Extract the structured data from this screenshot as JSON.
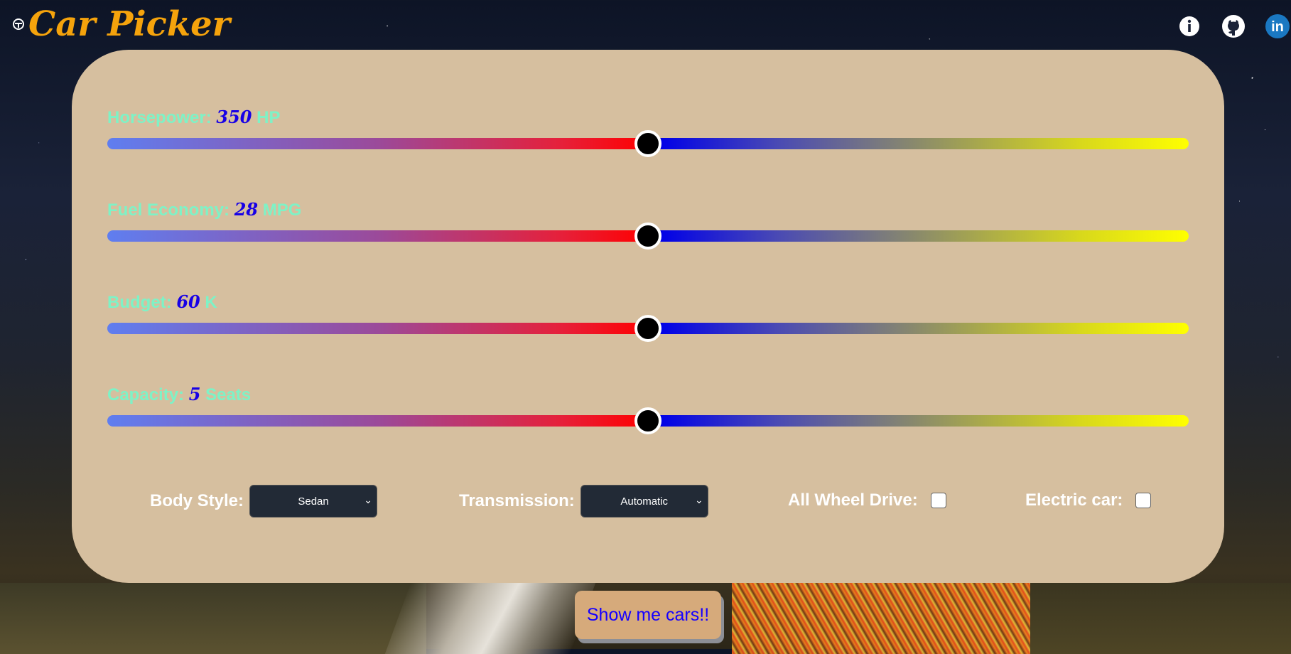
{
  "header": {
    "title": "Car Picker",
    "brand_icon": "steering-wheel-icon",
    "icons": [
      "info-icon",
      "github-icon",
      "linkedin-icon"
    ]
  },
  "sliders": [
    {
      "label": "Horsepower:",
      "value": "350",
      "unit": "HP",
      "level": 0.5
    },
    {
      "label": "Fuel Economy:",
      "value": "28",
      "unit": "MPG",
      "level": 0.5
    },
    {
      "label": "Budget:",
      "value": "60",
      "unit": "K",
      "level": 0.5
    },
    {
      "label": "Capacity:",
      "value": "5",
      "unit": "Seats",
      "level": 0.5
    }
  ],
  "filters": {
    "body_style": {
      "label": "Body Style:",
      "selected": "Sedan"
    },
    "transmission": {
      "label": "Transmission:",
      "selected": "Automatic"
    },
    "awd": {
      "label": "All Wheel Drive:",
      "checked": false
    },
    "electric": {
      "label": "Electric car:",
      "checked": false
    }
  },
  "submit_label": "Show me cars!!",
  "colors": {
    "brand": "#f5a30c",
    "card": "#d6bf9f",
    "label": "#7ef2c6",
    "value": "#1700e6",
    "button": "#d6aa7b"
  }
}
